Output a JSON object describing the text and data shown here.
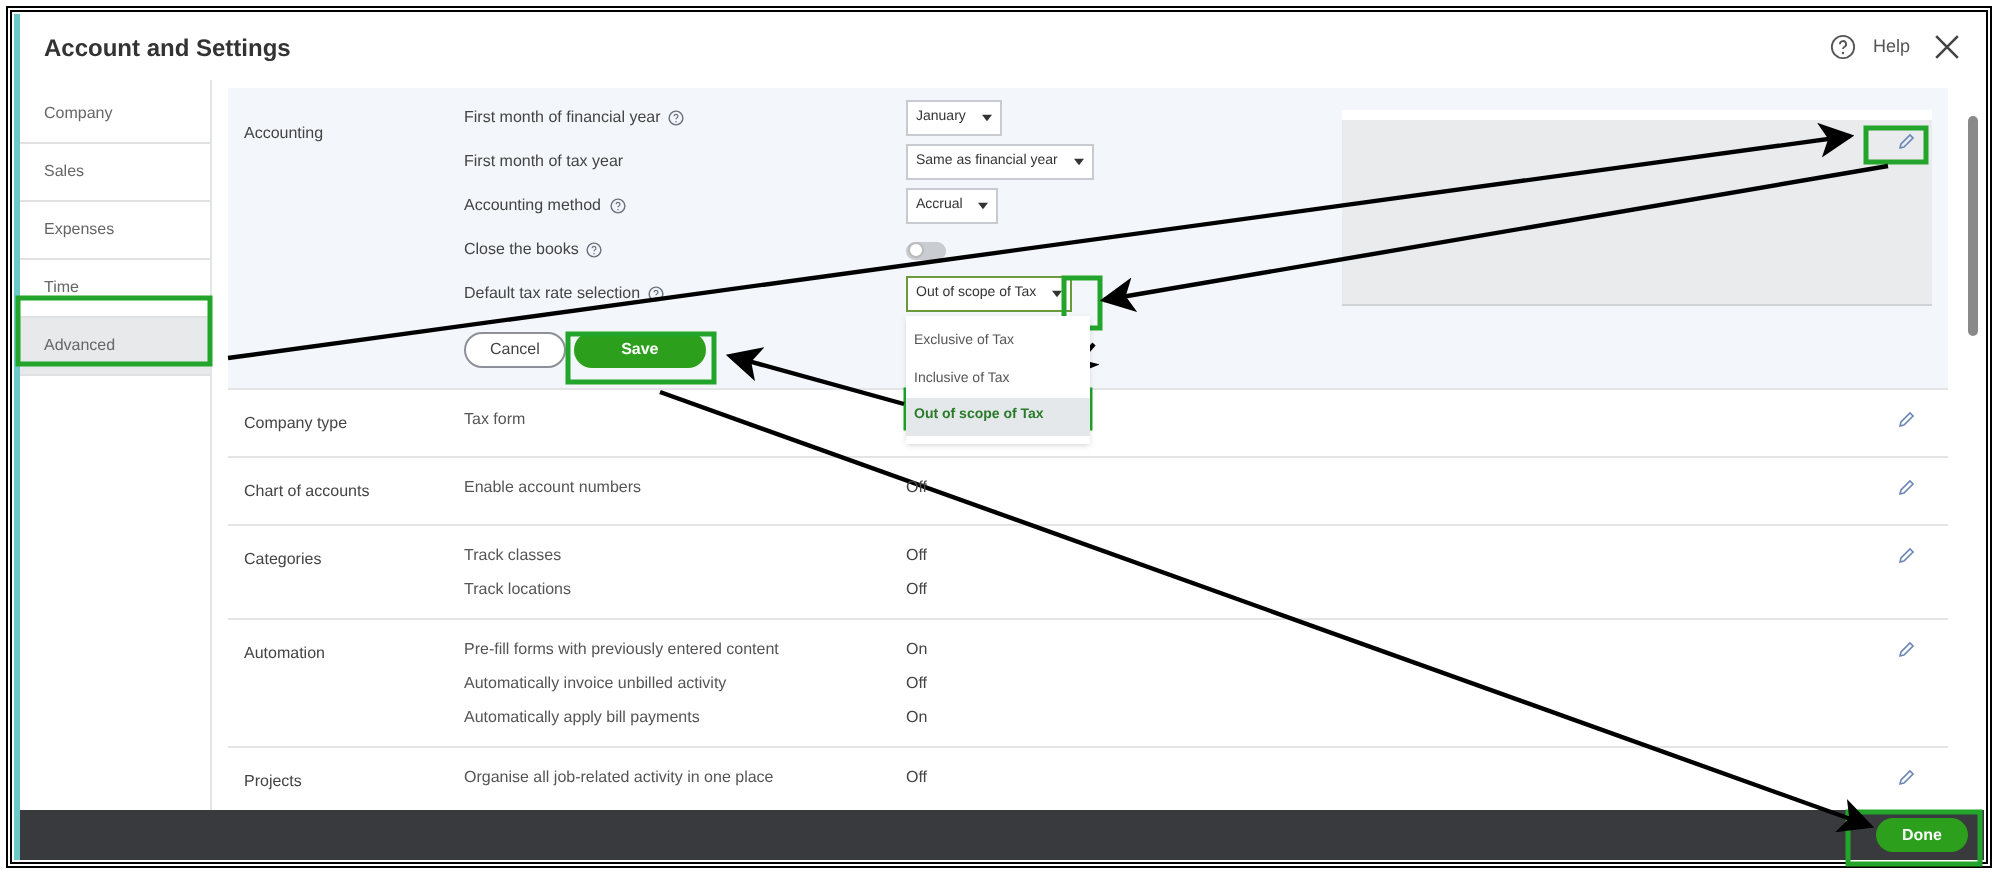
{
  "window": {
    "title": "Account and Settings",
    "help": "Help"
  },
  "sidebar": {
    "items": [
      {
        "label": "Company",
        "selected": false
      },
      {
        "label": "Sales",
        "selected": false
      },
      {
        "label": "Expenses",
        "selected": false
      },
      {
        "label": "Time",
        "selected": false
      },
      {
        "label": "Advanced",
        "selected": true
      }
    ]
  },
  "accounting": {
    "title": "Accounting",
    "fields": [
      {
        "kind": "select",
        "label": "First month of financial year",
        "help": true,
        "value": "January"
      },
      {
        "kind": "select",
        "label": "First month of tax year",
        "help": false,
        "value": "Same as financial year"
      },
      {
        "kind": "select",
        "label": "Accounting method",
        "help": true,
        "value": "Accrual"
      },
      {
        "kind": "toggle",
        "label": "Close the books",
        "help": true,
        "on": false
      },
      {
        "kind": "select",
        "label": "Default tax rate selection",
        "help": true,
        "value": "Out of scope of Tax",
        "expanded": true,
        "options": [
          {
            "label": "Exclusive of Tax",
            "selected": false
          },
          {
            "label": "Inclusive of Tax",
            "selected": false
          },
          {
            "label": "Out of scope of Tax",
            "selected": true
          }
        ]
      }
    ],
    "buttons": {
      "cancel": "Cancel",
      "save": "Save"
    }
  },
  "sections": [
    {
      "title": "Company type",
      "settings": [
        {
          "label": "Tax form"
        }
      ]
    },
    {
      "title": "Chart of accounts",
      "settings": [
        {
          "label": "Enable account numbers",
          "value": "Off"
        }
      ]
    },
    {
      "title": "Categories",
      "settings": [
        {
          "label": "Track classes",
          "value": "Off"
        },
        {
          "label": "Track locations",
          "value": "Off"
        }
      ]
    },
    {
      "title": "Automation",
      "settings": [
        {
          "label": "Pre-fill forms with previously entered content",
          "value": "On"
        },
        {
          "label": "Automatically invoice unbilled activity",
          "value": "Off"
        },
        {
          "label": "Automatically apply bill payments",
          "value": "On"
        }
      ]
    },
    {
      "title": "Projects",
      "settings": [
        {
          "label": "Organise all job-related activity in one place",
          "value": "Off"
        }
      ]
    }
  ],
  "footer": {
    "done": "Done"
  }
}
